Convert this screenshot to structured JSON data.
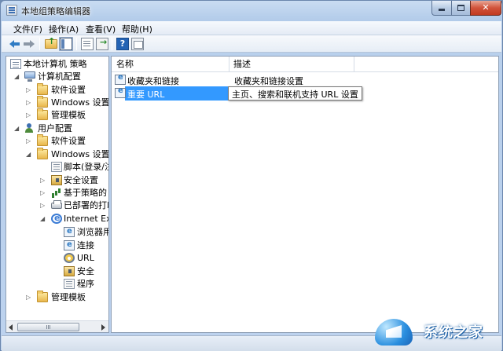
{
  "window": {
    "title": "本地组策略编辑器",
    "controls": {
      "minimize": "—",
      "maximize": "□",
      "close": "✕"
    }
  },
  "menu": {
    "items": [
      {
        "label": "文件(F)"
      },
      {
        "label": "操作(A)"
      },
      {
        "label": "查看(V)"
      },
      {
        "label": "帮助(H)"
      }
    ]
  },
  "toolbar": {
    "buttons": [
      "back-arrow-icon",
      "forward-arrow-icon",
      "up-folder-icon",
      "show-hide-tree-icon",
      "properties-doc-icon",
      "export-list-icon",
      "help-icon",
      "console-properties-icon"
    ]
  },
  "tree": {
    "nodes": [
      {
        "label": "本地计算机 策略",
        "icon": "policy-icon",
        "expander": ""
      },
      {
        "label": "计算机配置",
        "icon": "computer-icon",
        "expander": "◢"
      },
      {
        "label": "软件设置",
        "icon": "folder-icon",
        "expander": "▷"
      },
      {
        "label": "Windows 设置",
        "icon": "folder-icon",
        "expander": "▷"
      },
      {
        "label": "管理模板",
        "icon": "folder-icon",
        "expander": "▷"
      },
      {
        "label": "用户配置",
        "icon": "user-icon",
        "expander": "◢"
      },
      {
        "label": "软件设置",
        "icon": "folder-icon",
        "expander": "▷"
      },
      {
        "label": "Windows 设置",
        "icon": "folder-icon",
        "expander": "◢"
      },
      {
        "label": "脚本(登录/注",
        "icon": "script-icon",
        "expander": ""
      },
      {
        "label": "安全设置",
        "icon": "security-icon",
        "expander": "▷"
      },
      {
        "label": "基于策略的 Q",
        "icon": "qos-chart-icon",
        "expander": "▷"
      },
      {
        "label": "已部署的打印",
        "icon": "printer-icon",
        "expander": "▷"
      },
      {
        "label": "Internet Exp",
        "icon": "ie-icon",
        "expander": "◢"
      },
      {
        "label": "浏览器用户",
        "icon": "ie-settings-icon",
        "expander": ""
      },
      {
        "label": "连接",
        "icon": "connection-icon",
        "expander": ""
      },
      {
        "label": "URL",
        "icon": "url-icon",
        "expander": ""
      },
      {
        "label": "安全",
        "icon": "lock-icon",
        "expander": ""
      },
      {
        "label": "程序",
        "icon": "programs-icon",
        "expander": ""
      },
      {
        "label": "管理模板",
        "icon": "folder-icon",
        "expander": "▷"
      }
    ]
  },
  "list": {
    "columns": {
      "name": "名称",
      "desc": "描述"
    },
    "rows": [
      {
        "name": "收藏夹和链接",
        "desc": "收藏夹和链接设置"
      },
      {
        "name": "重要 URL",
        "desc": "主页、搜索和联机支持 URL 设置",
        "selected": true
      }
    ]
  },
  "watermark": {
    "text": "系统之家"
  }
}
